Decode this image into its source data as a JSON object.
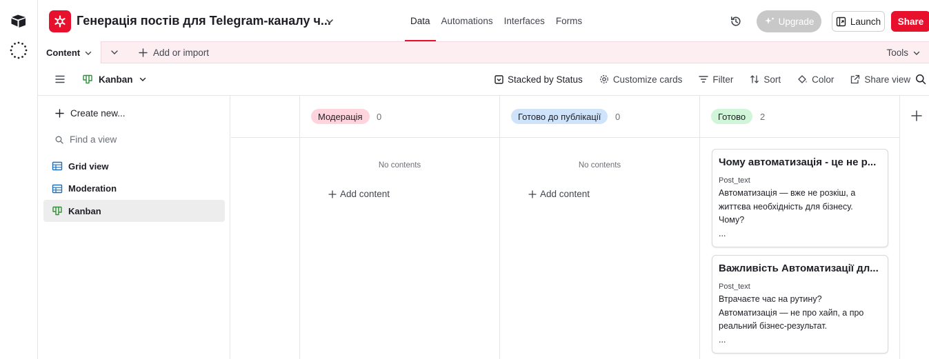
{
  "header": {
    "base_title": "Генерація постів для Telegram-каналу ч...",
    "nav": [
      {
        "label": "Data",
        "active": true
      },
      {
        "label": "Automations",
        "active": false
      },
      {
        "label": "Interfaces",
        "active": false
      },
      {
        "label": "Forms",
        "active": false
      }
    ],
    "upgrade_label": "Upgrade",
    "launch_label": "Launch",
    "share_label": "Share"
  },
  "tablebar": {
    "table_tab": "Content",
    "add_import": "Add or import",
    "tools": "Tools"
  },
  "viewbar": {
    "view_name": "Kanban",
    "stacked": "Stacked by Status",
    "customize": "Customize cards",
    "filter": "Filter",
    "sort": "Sort",
    "color": "Color",
    "share_view": "Share view"
  },
  "sidebar": {
    "create_new": "Create new...",
    "find_placeholder": "Find a view",
    "views": [
      {
        "label": "Grid view",
        "icon": "grid-icon",
        "active": false
      },
      {
        "label": "Moderation",
        "icon": "grid-icon",
        "active": false
      },
      {
        "label": "Kanban",
        "icon": "kanban-icon",
        "active": true
      }
    ]
  },
  "board": {
    "columns": [
      {
        "label": "Модерація",
        "count": "0",
        "color": "#ffd4dc",
        "empty_text": "No contents",
        "add_label": "Add content"
      },
      {
        "label": "Готово до публікації",
        "count": "0",
        "color": "#cfe3fb",
        "empty_text": "No contents",
        "add_label": "Add content"
      },
      {
        "label": "Готово",
        "count": "2",
        "color": "#d1f5d8"
      }
    ],
    "cards": [
      {
        "title": "Чому автоматизація - це не р...",
        "field": "Post_text",
        "lines": [
          "Автоматизація — вже не розкіш, а",
          "життєва необхідність для бізнесу.",
          "Чому?",
          "..."
        ]
      },
      {
        "title": "Важливість Автоматизації дл...",
        "field": "Post_text",
        "lines": [
          "Втрачаєте час на рутину?",
          "Автоматизація — не про хайп, а про",
          "реальний бізнес-результат.",
          "..."
        ]
      }
    ]
  },
  "colors": {
    "accent": "#e8112d",
    "tablebar_bg": "#fdeef2"
  }
}
